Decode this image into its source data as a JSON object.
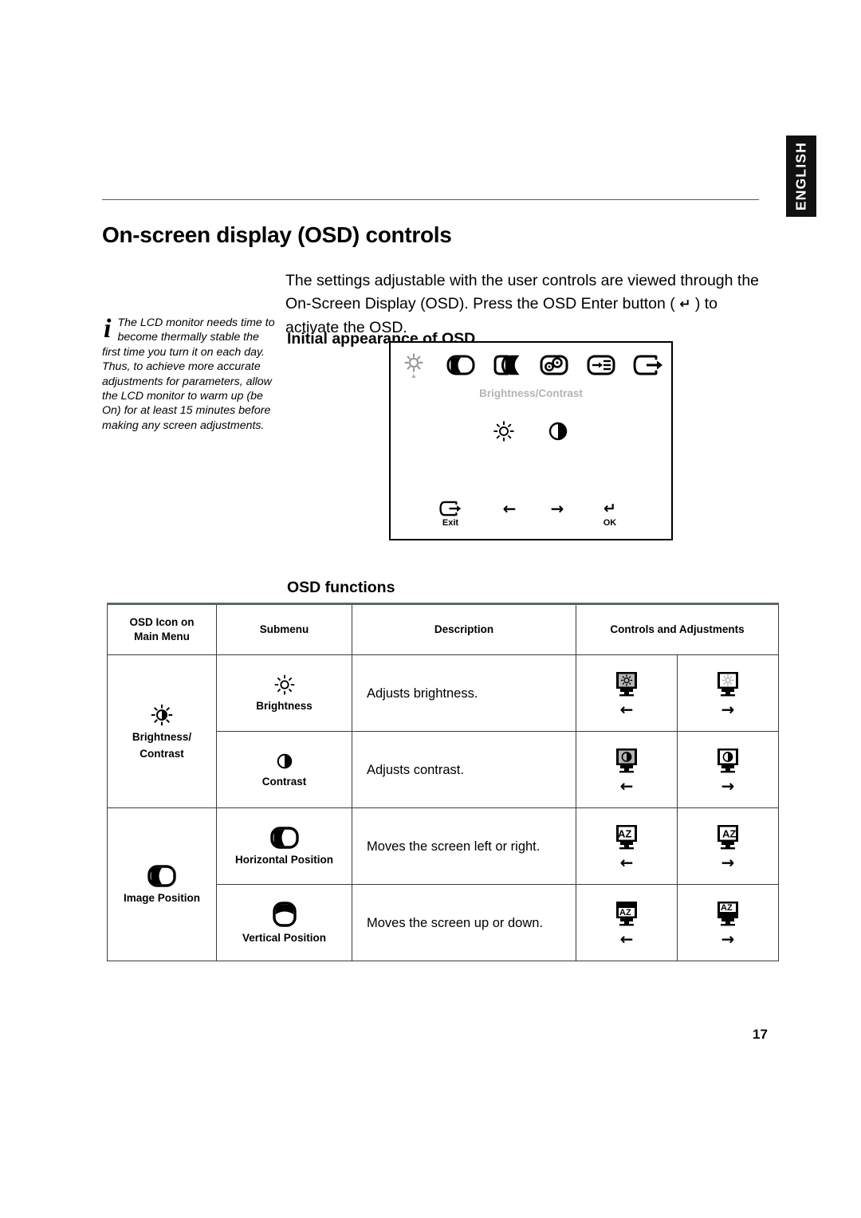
{
  "side_tab": {
    "label": "ENGLISH"
  },
  "page": {
    "title": "On-screen display (OSD) controls",
    "number": "17"
  },
  "intro": {
    "part1": "The settings adjustable with the user controls are viewed through the On-Screen Display (OSD). Press the OSD Enter button ( ",
    "enter_symbol": "↵",
    "part2": " ) to activate the OSD."
  },
  "note": {
    "icon": "information-i",
    "text": "The LCD monitor needs time to become thermally stable the first time you turn it on each day. Thus, to achieve more accurate adjustments for parameters, allow the LCD monitor to warm up (be On) for at least 15 minutes before making any screen adjustments."
  },
  "headings": {
    "initial_appearance": "Initial appearance of OSD",
    "osd_functions": "OSD functions"
  },
  "osd_panel": {
    "title": "Brightness/Contrast",
    "top_icons": [
      {
        "name": "brightness-contrast-icon",
        "selected": true
      },
      {
        "name": "image-position-icon",
        "selected": false
      },
      {
        "name": "image-setup-icon",
        "selected": false
      },
      {
        "name": "image-properties-icon",
        "selected": false
      },
      {
        "name": "options-icon",
        "selected": false
      },
      {
        "name": "exit-icon",
        "selected": false
      }
    ],
    "sub_icons": [
      {
        "name": "brightness-icon"
      },
      {
        "name": "contrast-icon"
      }
    ],
    "footer": [
      {
        "key": "exit",
        "icon": "exit-icon",
        "label": "Exit"
      },
      {
        "key": "left",
        "icon": "arrow-left-icon",
        "label": ""
      },
      {
        "key": "right",
        "icon": "arrow-right-icon",
        "label": ""
      },
      {
        "key": "ok",
        "icon": "enter-icon",
        "label": "OK"
      }
    ]
  },
  "table": {
    "headers": {
      "icon": "OSD Icon on Main Menu",
      "icon_line1": "OSD Icon on",
      "icon_line2": "Main Menu",
      "submenu": "Submenu",
      "description": "Description",
      "controls": "Controls and Adjustments"
    },
    "groups": [
      {
        "main_icon": "brightness-contrast-icon",
        "main_label_line1": "Brightness/",
        "main_label_line2": "Contrast",
        "rows": [
          {
            "sub_icon": "brightness-icon",
            "submenu": "Brightness",
            "description": "Adjusts brightness.",
            "control_left": {
              "icon": "monitor-brightness-dim-icon",
              "arrow": "←"
            },
            "control_right": {
              "icon": "monitor-brightness-bright-icon",
              "arrow": "→"
            }
          },
          {
            "sub_icon": "contrast-icon",
            "submenu": "Contrast",
            "description": "Adjusts contrast.",
            "control_left": {
              "icon": "monitor-contrast-low-icon",
              "arrow": "←"
            },
            "control_right": {
              "icon": "monitor-contrast-high-icon",
              "arrow": "→"
            }
          }
        ]
      },
      {
        "main_icon": "image-position-icon",
        "main_label_line1": "Image Position",
        "main_label_line2": "",
        "rows": [
          {
            "sub_icon": "horizontal-position-icon",
            "submenu": "Horizontal Position",
            "description": "Moves the screen left or right.",
            "control_left": {
              "icon": "monitor-shift-left-icon",
              "arrow": "←"
            },
            "control_right": {
              "icon": "monitor-shift-right-icon",
              "arrow": "→"
            }
          },
          {
            "sub_icon": "vertical-position-icon",
            "submenu": "Vertical Position",
            "description": "Moves the screen up or down.",
            "control_left": {
              "icon": "monitor-shift-down-icon",
              "arrow": "←"
            },
            "control_right": {
              "icon": "monitor-shift-up-icon",
              "arrow": "→"
            }
          }
        ]
      }
    ]
  },
  "colors": {
    "osd_title_gray": "#b4b4b4",
    "tab_background": "#111111",
    "rule": "#555a5e"
  }
}
